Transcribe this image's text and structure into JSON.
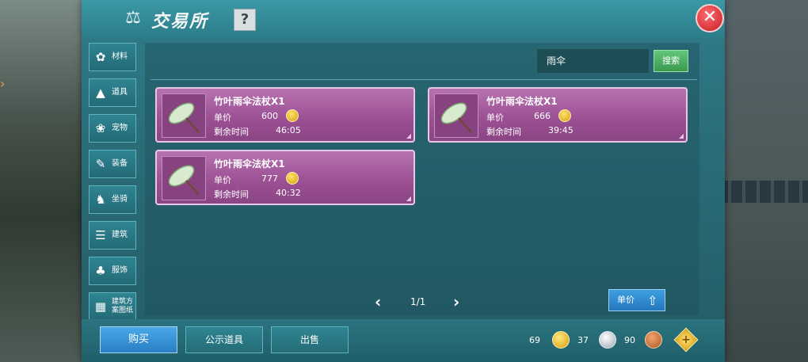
{
  "window": {
    "title": "交易所",
    "help_label": "?",
    "close_label": "✕"
  },
  "sidebar": {
    "items": [
      {
        "label": "材料",
        "icon": "materials-icon",
        "glyph": "✿"
      },
      {
        "label": "道具",
        "icon": "item-icon",
        "glyph": "▲"
      },
      {
        "label": "宠物",
        "icon": "pet-paw-icon",
        "glyph": "❀"
      },
      {
        "label": "装备",
        "icon": "equipment-icon",
        "glyph": "✎"
      },
      {
        "label": "坐骑",
        "icon": "mount-icon",
        "glyph": "♞"
      },
      {
        "label": "建筑",
        "icon": "building-icon",
        "glyph": "☰"
      },
      {
        "label": "服饰",
        "icon": "clothing-icon",
        "glyph": "♣"
      },
      {
        "label": "建筑方案图纸",
        "icon": "blueprint-icon",
        "glyph": "▦"
      }
    ]
  },
  "search": {
    "value": "雨伞",
    "button_label": "搜索"
  },
  "listings": [
    {
      "name": "竹叶雨伞法杖X1",
      "price_label": "单价",
      "price": "600",
      "time_label": "剩余时间",
      "time": "46:05",
      "icon": "bamboo-umbrella-icon"
    },
    {
      "name": "竹叶雨伞法杖X1",
      "price_label": "单价",
      "price": "666",
      "time_label": "剩余时间",
      "time": "39:45",
      "icon": "bamboo-umbrella-icon"
    },
    {
      "name": "竹叶雨伞法杖X1",
      "price_label": "单价",
      "price": "777",
      "time_label": "剩余时间",
      "time": "40:32",
      "icon": "bamboo-umbrella-icon"
    }
  ],
  "pagination": {
    "current": "1/1"
  },
  "sort": {
    "label": "单价",
    "direction": "ascending"
  },
  "bottom_tabs": {
    "buy": "购买",
    "publish": "公示道具",
    "sell": "出售"
  },
  "currency": {
    "gold": "69",
    "silver": "37",
    "copper": "90"
  },
  "colors": {
    "panel": "#2a6d79",
    "card": "#a35a9c",
    "accent_blue": "#2a7ec4",
    "search_green": "#3a9a4f",
    "close_red": "#c41e2a"
  }
}
